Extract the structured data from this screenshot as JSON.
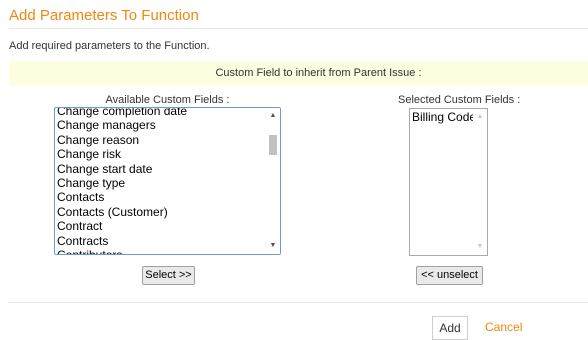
{
  "dialog": {
    "title": "Add Parameters To Function",
    "description": "Add required parameters to the Function."
  },
  "inherit_section": {
    "label": "Custom Field to inherit from Parent Issue :"
  },
  "available": {
    "header": "Available Custom Fields :",
    "items": [
      "Change completion date",
      "Change managers",
      "Change reason",
      "Change risk",
      "Change start date",
      "Change type",
      "Contacts",
      "Contacts (Customer)",
      "Contract",
      "Contracts",
      "Contributors"
    ],
    "select_label": "Select >>"
  },
  "selected": {
    "header": "Selected Custom Fields :",
    "items": [
      "Billing Code"
    ],
    "unselect_label": "<< unselect"
  },
  "footer": {
    "add_label": "Add",
    "cancel_label": "Cancel"
  },
  "colors": {
    "accent": "#f0870f",
    "inherit_bar": "#fdfde0"
  },
  "icons": {
    "scroll_up": "▲",
    "scroll_down": "▼"
  }
}
